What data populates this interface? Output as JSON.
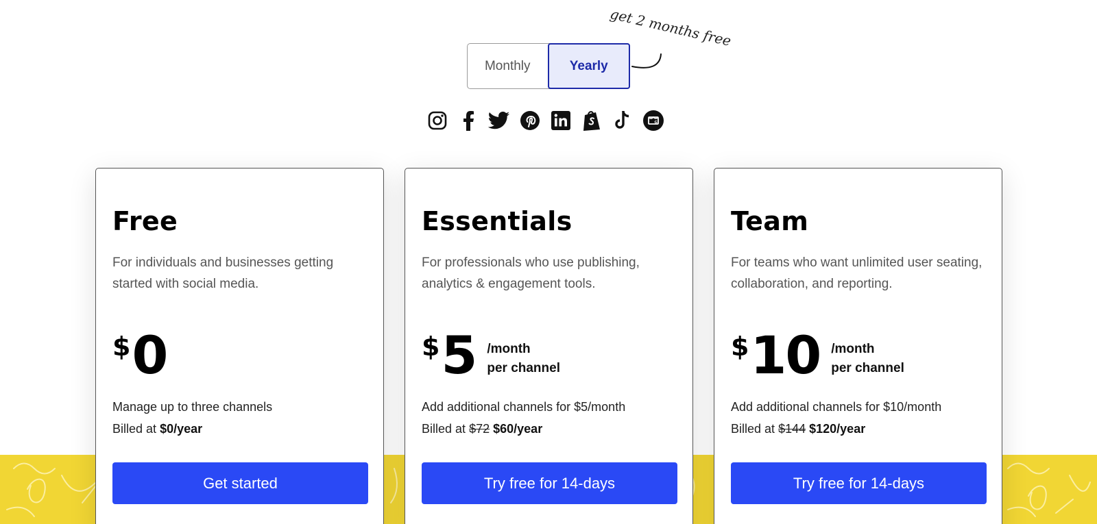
{
  "billing_toggle": {
    "monthly_label": "Monthly",
    "yearly_label": "Yearly",
    "selected": "Yearly",
    "promo_note": "get 2 months free"
  },
  "social_icons": [
    "instagram-icon",
    "facebook-icon",
    "twitter-icon",
    "pinterest-icon",
    "linkedin-icon",
    "shopify-icon",
    "tiktok-icon",
    "google-business-icon"
  ],
  "plans": [
    {
      "name": "Free",
      "description": "For individuals and businesses getting started with social media.",
      "currency": "$",
      "amount": "0",
      "unit_line1": "",
      "unit_line2": "",
      "feature": "Manage up to three channels",
      "billed_prefix": "Billed at",
      "billed_old": "",
      "billed_new": "$0/year",
      "cta": "Get started"
    },
    {
      "name": "Essentials",
      "description": "For professionals who use publishing, analytics & engagement tools.",
      "currency": "$",
      "amount": "5",
      "unit_line1": "/month",
      "unit_line2": "per channel",
      "feature": "Add additional channels for $5/month",
      "billed_prefix": "Billed at",
      "billed_old": "$72",
      "billed_new": "$60/year",
      "cta": "Try free for 14-days"
    },
    {
      "name": "Team",
      "description": "For teams who want unlimited user seating, collaboration, and reporting.",
      "currency": "$",
      "amount": "10",
      "unit_line1": "/month",
      "unit_line2": "per channel",
      "feature": "Add additional channels for $10/month",
      "billed_prefix": "Billed at",
      "billed_old": "$144",
      "billed_new": "$120/year",
      "cta": "Try free for 14-days"
    }
  ],
  "colors": {
    "accent": "#2a49f5",
    "toggle_active_bg": "#e8ebfb",
    "toggle_active_text": "#1d2aa8",
    "band_yellow": "#f1d634"
  }
}
